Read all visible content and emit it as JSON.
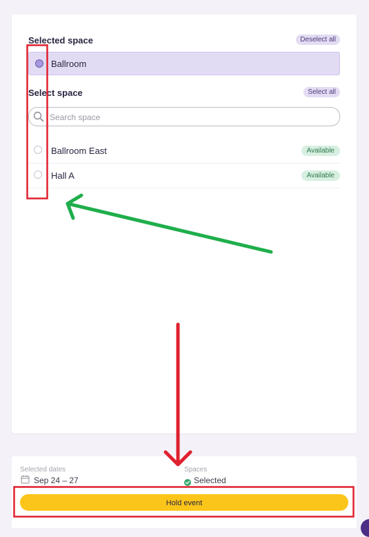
{
  "selected_section": {
    "title": "Selected space",
    "deselect_label": "Deselect all",
    "item": "Ballroom"
  },
  "select_section": {
    "title": "Select space",
    "select_all_label": "Select all",
    "search_placeholder": "Search space",
    "items": [
      {
        "label": "Ballroom East",
        "status": "Available"
      },
      {
        "label": "Hall A",
        "status": "Available"
      }
    ]
  },
  "footer": {
    "dates_label": "Selected dates",
    "dates_value": "Sep 24 – 27",
    "spaces_label": "Spaces",
    "spaces_value": "Selected",
    "hold_button": "Hold event"
  },
  "colors": {
    "accent_purple": "#e2dbf4",
    "available_green": "#2f7a4c",
    "hold_yellow": "#fcc51a",
    "annotation_red": "#e0202e",
    "annotation_green": "#1fae4b"
  },
  "icons": [
    "search-icon",
    "calendar-icon",
    "check-circle-icon"
  ]
}
